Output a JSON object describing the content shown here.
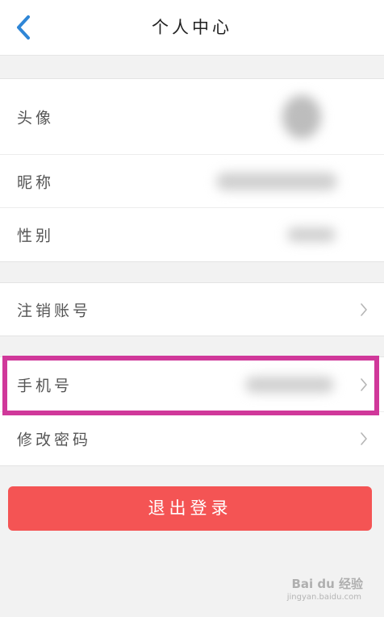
{
  "header": {
    "title": "个人中心"
  },
  "profile": {
    "items": [
      {
        "label": "头像"
      },
      {
        "label": "昵称"
      },
      {
        "label": "性别"
      }
    ]
  },
  "account": {
    "cancel_label": "注销账号"
  },
  "security": {
    "phone_label": "手机号",
    "password_label": "修改密码"
  },
  "actions": {
    "logout_label": "退出登录"
  },
  "watermark": {
    "text": "Bai du 经验",
    "sub": "jingyan.baidu.com"
  },
  "colors": {
    "accent_blue": "#2f86d6",
    "logout_red": "#f45454",
    "highlight_magenta": "#d0389a"
  }
}
